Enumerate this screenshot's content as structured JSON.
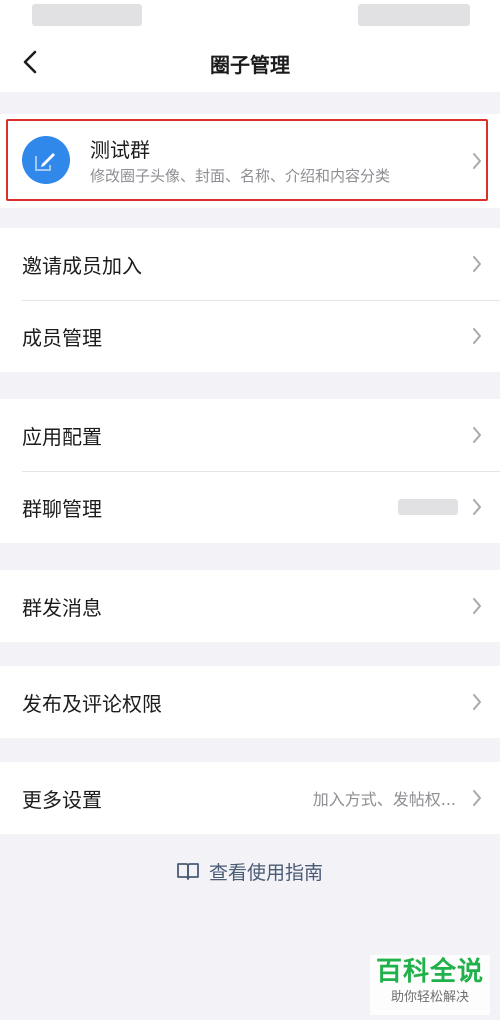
{
  "nav": {
    "title": "圈子管理"
  },
  "circle": {
    "name": "测试群",
    "description": "修改圈子头像、封面、名称、介绍和内容分类"
  },
  "groups": [
    {
      "items": [
        {
          "id": "invite",
          "label": "邀请成员加入"
        },
        {
          "id": "members",
          "label": "成员管理"
        }
      ]
    },
    {
      "items": [
        {
          "id": "app-config",
          "label": "应用配置"
        },
        {
          "id": "group-chat",
          "label": "群聊管理"
        }
      ]
    },
    {
      "items": [
        {
          "id": "broadcast",
          "label": "群发消息"
        }
      ]
    },
    {
      "items": [
        {
          "id": "permissions",
          "label": "发布及评论权限"
        }
      ]
    },
    {
      "items": [
        {
          "id": "more",
          "label": "更多设置",
          "value": "加入方式、发帖权..."
        }
      ]
    }
  ],
  "guide": {
    "label": "查看使用指南",
    "icon": "book-icon"
  },
  "watermark": {
    "main": "百科全说",
    "sub": "助你轻松解决"
  },
  "colors": {
    "accent": "#2f88ea",
    "highlight": "#d9302b",
    "watermark": "#20b14a"
  }
}
